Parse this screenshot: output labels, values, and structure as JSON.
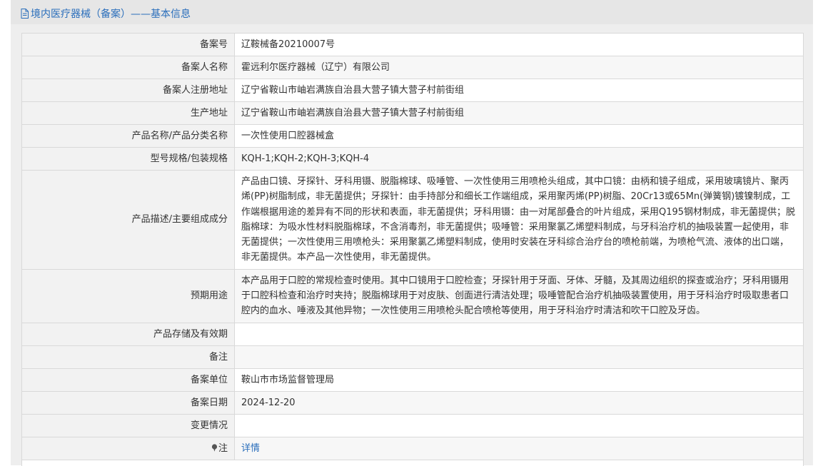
{
  "header": {
    "title": "境内医疗器械（备案）——基本信息",
    "icon": "document-icon",
    "accent_color": "#2a6ebb"
  },
  "rows": [
    {
      "label": "备案号",
      "value": "辽鞍械备20210007号"
    },
    {
      "label": "备案人名称",
      "value": "霍远利尔医疗器械（辽宁）有限公司"
    },
    {
      "label": "备案人注册地址",
      "value": "辽宁省鞍山市岫岩满族自治县大营子镇大营子村前街组"
    },
    {
      "label": "生产地址",
      "value": "辽宁省鞍山市岫岩满族自治县大营子镇大营子村前街组"
    },
    {
      "label": "产品名称/产品分类名称",
      "value": "一次性使用口腔器械盒"
    },
    {
      "label": "型号规格/包装规格",
      "value": "KQH-1;KQH-2;KQH-3;KQH-4"
    },
    {
      "label": "产品描述/主要组成成分",
      "value": "产品由口镜、牙探针、牙科用镊、脱脂棉球、吸唾管、一次性使用三用喷枪头组成，其中口镜：由柄和镜子组成，采用玻璃镜片、聚丙烯(PP)树脂制成，非无菌提供；牙探针：由手持部分和细长工作端组成，采用聚丙烯(PP)树脂、20Cr13或65Mn(弹簧钢)镀镍制成，工作端根据用途的差异有不同的形状和表面，非无菌提供；牙科用镊：由一对尾部叠合的叶片组成，采用Q195钢材制成，非无菌提供；脱脂棉球：为吸水性材料脱脂棉球，不含消毒剂，非无菌提供；吸唾管：采用聚氯乙烯塑料制成，与牙科治疗机的抽吸装置一起使用，非无菌提供；一次性使用三用喷枪头：采用聚氯乙烯塑料制成，使用时安装在牙科综合治疗台的喷枪前端，为喷枪气流、液体的出口端，非无菌提供。本产品一次性使用，非无菌提供。"
    },
    {
      "label": "预期用途",
      "value": "本产品用于口腔的常规检查时使用。其中口镜用于口腔检查；牙探针用于牙面、牙体、牙髓，及其周边组织的探查或治疗；牙科用镊用于口腔科检查和治疗时夹持；脱脂棉球用于对皮肤、创面进行清洁处理；吸唾管配合治疗机抽吸装置使用，用于牙科治疗时吸取患者口腔内的血水、唾液及其他异物；一次性使用三用喷枪头配合喷枪等使用，用于牙科治疗时清洁和吹干口腔及牙齿。"
    },
    {
      "label": "产品存储及有效期",
      "value": ""
    },
    {
      "label": "备注",
      "value": ""
    },
    {
      "label": "备案单位",
      "value": "鞍山市市场监督管理局"
    },
    {
      "label": "备案日期",
      "value": "2024-12-20"
    },
    {
      "label": "变更情况",
      "value": ""
    },
    {
      "label": "注",
      "value": "详情",
      "icon": "pin-icon"
    }
  ]
}
